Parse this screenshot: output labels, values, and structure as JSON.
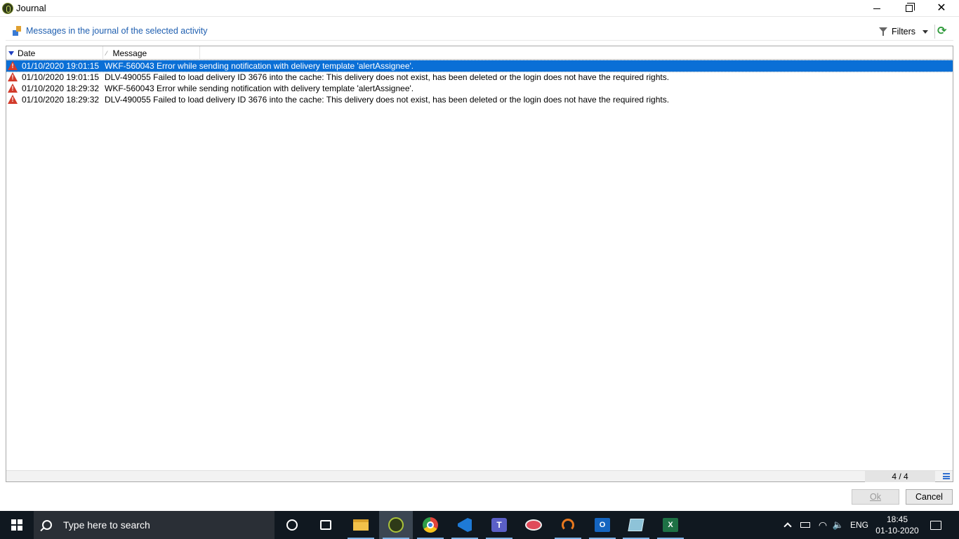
{
  "window": {
    "title": "Journal",
    "close_glyph": "✕"
  },
  "toolbar": {
    "heading": "Messages in the journal of the selected activity",
    "filters_label": "Filters",
    "refresh_glyph": "⟳"
  },
  "grid": {
    "columns": [
      {
        "label": "Date"
      },
      {
        "label": "Message"
      }
    ],
    "rows": [
      {
        "level": "warning-icon",
        "date": "01/10/2020 19:01:15",
        "message": "WKF-560043 Error while sending notification with delivery template 'alertAssignee'.",
        "selected": true
      },
      {
        "level": "warning-icon",
        "date": "01/10/2020 19:01:15",
        "message": "DLV-490055 Failed to load delivery ID 3676 into the cache: This delivery does not exist, has been deleted or the login does not have the required rights.",
        "selected": false
      },
      {
        "level": "warning-icon",
        "date": "01/10/2020 18:29:32",
        "message": "WKF-560043 Error while sending notification with delivery template 'alertAssignee'.",
        "selected": false
      },
      {
        "level": "warning-icon",
        "date": "01/10/2020 18:29:32",
        "message": "DLV-490055 Failed to load delivery ID 3676 into the cache: This delivery does not exist, has been deleted or the login does not have the required rights.",
        "selected": false
      }
    ],
    "count": "4 / 4",
    "selection_color": "#0a6fd6",
    "warning_color": "#d23b2b"
  },
  "buttons": {
    "ok": "Ok",
    "cancel": "Cancel"
  },
  "taskbar": {
    "search_placeholder": "Type here to search",
    "language": "ENG",
    "time": "18:45",
    "date": "01-10-2020",
    "apps": [
      "cortana-icon",
      "task-view-icon",
      "file-explorer-icon",
      "journal-app-icon",
      "chrome-icon",
      "vscode-icon",
      "teams-icon",
      "paint-icon",
      "app-ring-icon",
      "outlook-icon",
      "notepad-icon",
      "excel-icon"
    ],
    "teams_letter": "T",
    "outlook_letter": "O",
    "excel_letter": "X",
    "wifi_glyph": "◠",
    "speaker_glyph": "🔈"
  }
}
